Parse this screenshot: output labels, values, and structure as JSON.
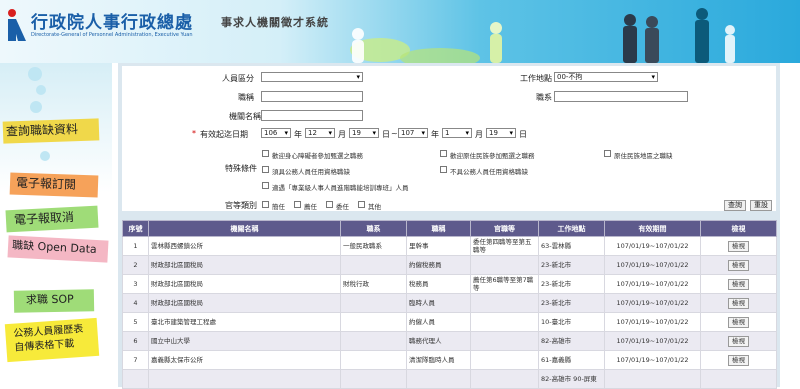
{
  "header": {
    "org_title": "行政院人事行政總處",
    "org_subtitle": "Directorate-General of Personnel Administration, Executive Yuan",
    "system_title": "事求人機關徵才系統"
  },
  "nav": {
    "query": "查詢職缺資料",
    "subscribe": "電子報訂閱",
    "cancel": "電子報取消",
    "opendata": "職缺 Open Data",
    "sop": "求職 SOP",
    "resume": "公務人員履歷表 自傳表格下載"
  },
  "form": {
    "personnel_category_label": "人員區分",
    "personnel_category_value": "",
    "work_location_label": "工作地點",
    "work_location_value": "00-不拘",
    "job_title_label": "職稱",
    "job_series_label": "職系",
    "agency_label": "機關名稱",
    "required_mark": "*",
    "valid_date_label": "有效起迄日期",
    "start_year": "106",
    "start_month": "12",
    "start_day": "19",
    "end_year": "107",
    "end_month": "1",
    "end_day": "19",
    "unit_year": "年",
    "unit_month": "月",
    "unit_day": "日",
    "tilde": "~",
    "special_label": "特殊條件",
    "special_options": [
      "歡迎身心障礙者參加甄選之職務",
      "歡迎原住民族參加甄選之職務",
      "原住民族地區之職缺",
      "須具公務人員任用資格職缺",
      "不具公務人員任用資格職缺",
      "適遇「專業級人事人員進階職能培訓專班」人員"
    ],
    "rank_label": "官等類別",
    "rank_options": [
      "簡任",
      "薦任",
      "委任",
      "其他"
    ],
    "search_button": "查詢",
    "reset_button": "重設"
  },
  "table": {
    "headers": [
      "序號",
      "機關名稱",
      "職系",
      "職稱",
      "官職等",
      "工作地點",
      "有效期間",
      "檢視"
    ],
    "view_label": "檢視",
    "rows": [
      {
        "no": "1",
        "agency": "雲林縣西螺鎮公所",
        "series": "一般民政職系",
        "title": "里幹事",
        "rank": "委任第四職等至第五職等",
        "location": "63-雲林縣",
        "period": "107/01/19~107/01/22"
      },
      {
        "no": "2",
        "agency": "財政部北區國稅局",
        "series": "",
        "title": "約僱稅務員",
        "rank": "",
        "location": "23-新北市",
        "period": "107/01/19~107/01/22"
      },
      {
        "no": "3",
        "agency": "財政部北區國稅局",
        "series": "財稅行政",
        "title": "稅務員",
        "rank": "薦任第6職等至第7職等",
        "location": "23-新北市",
        "period": "107/01/19~107/01/22"
      },
      {
        "no": "4",
        "agency": "財政部北區國稅局",
        "series": "",
        "title": "臨時人員",
        "rank": "",
        "location": "23-新北市",
        "period": "107/01/19~107/01/22"
      },
      {
        "no": "5",
        "agency": "臺北市建築管理工程處",
        "series": "",
        "title": "約僱人員",
        "rank": "",
        "location": "10-臺北市",
        "period": "107/01/19~107/01/22"
      },
      {
        "no": "6",
        "agency": "國立中山大學",
        "series": "",
        "title": "職務代理人",
        "rank": "",
        "location": "82-高雄市",
        "period": "107/01/19~107/01/22"
      },
      {
        "no": "7",
        "agency": "嘉義縣太保市公所",
        "series": "",
        "title": "清潔隊臨時人員",
        "rank": "",
        "location": "61-嘉義縣",
        "period": "107/01/19~107/01/22"
      },
      {
        "no": "",
        "agency": "",
        "series": "",
        "title": "",
        "rank": "",
        "location": "82-高雄市 90-屏東",
        "period": ""
      }
    ]
  },
  "colors": {
    "header_accent": "#1a5fa8",
    "table_header": "#5e5a8c",
    "required": "#d00000"
  }
}
